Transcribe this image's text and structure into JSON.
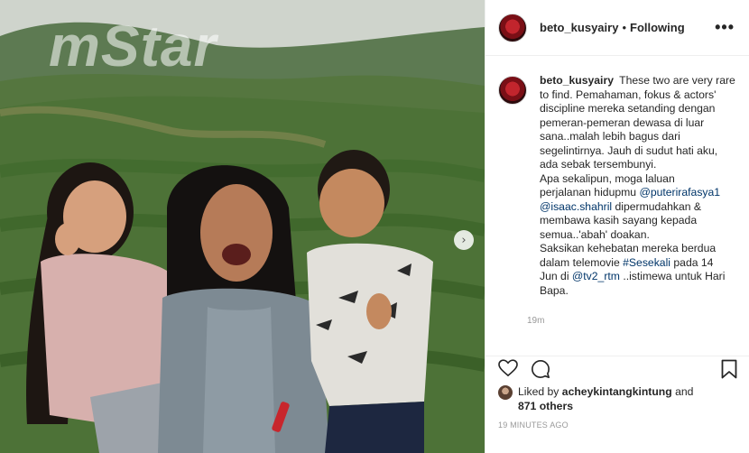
{
  "photo": {
    "watermark": "mStar",
    "next_icon": "chevron-right-icon",
    "next_glyph": "›"
  },
  "header": {
    "username": "beto_kusyairy",
    "separator": "•",
    "follow_status": "Following",
    "more_glyph": "•••"
  },
  "caption": {
    "username": "beto_kusyairy",
    "lines": [
      "These two are very rare",
      "to find. Pemahaman, fokus & actors'",
      "discipline mereka setanding dengan",
      "pemeran-pemeran dewasa di luar",
      "sana..malah lebih bagus dari",
      "segelintirnya. Jauh di sudut hati aku,",
      "ada sebak tersembunyi.",
      "Apa sekalipun, moga laluan",
      "perjalanan hidupmu",
      "dipermudahkan &",
      "membawa kasih sayang kepada",
      "semua..'abah' doakan.",
      "Saksikan kehebatan mereka berdua",
      "dalam telemovie",
      "pada 14",
      "Jun di",
      "..istimewa untuk Hari",
      "Bapa."
    ],
    "mentions": {
      "puteri": "@puterirafasya1",
      "isaac": "@isaac.shahril",
      "hashtag": "#Sesekali",
      "tv2": "@tv2_rtm"
    },
    "time": "19m"
  },
  "actions": {
    "like_icon": "heart-icon",
    "comment_icon": "comment-icon",
    "save_icon": "bookmark-icon",
    "liked_by_prefix": "Liked by",
    "liked_by_user": "acheykintangkintung",
    "and": "and",
    "others": "871 others",
    "timestamp": "19 MINUTES AGO"
  },
  "colors": {
    "link": "#003569",
    "text": "#262626",
    "muted": "#999999",
    "border": "#efefef"
  }
}
